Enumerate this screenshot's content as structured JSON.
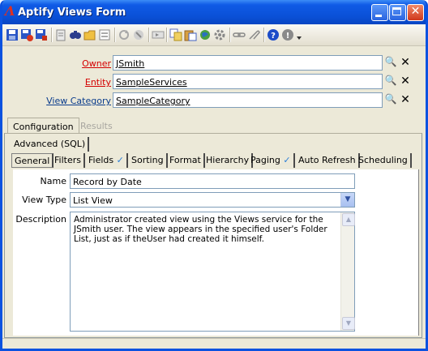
{
  "window": {
    "title": "Aptify Views Form",
    "app_logo": "Λ"
  },
  "colors": {
    "title_bar": "#0a50d6",
    "required_label": "#d40000",
    "link_label": "#0a3c8c",
    "frame": "#ece9d8"
  },
  "toolbar_icons": [
    "save-icon",
    "save-and-new-icon",
    "save-and-close-icon",
    "delete-icon",
    "find-icon",
    "open-icon",
    "form-icon",
    "refresh-icon",
    "clear-icon",
    "navigate-icon",
    "copy-icon",
    "paste-icon",
    "web-icon",
    "settings-icon",
    "link-icon",
    "attach-icon",
    "help-icon",
    "info-icon",
    "more-icon"
  ],
  "fields": [
    {
      "label": "Owner",
      "value": "JSmith",
      "label_color": "red"
    },
    {
      "label": "Entity",
      "value": "SampleServices",
      "label_color": "red"
    },
    {
      "label": "View Category",
      "value": "SampleCategory",
      "label_color": "blue"
    }
  ],
  "main_tabs": [
    {
      "label": "Configuration",
      "active": true
    },
    {
      "label": "Results",
      "active": false
    }
  ],
  "sub_tabs_row1": [
    {
      "label": "Advanced (SQL)"
    }
  ],
  "sub_tabs_row2": [
    {
      "label": "General",
      "active": true,
      "check": ""
    },
    {
      "label": "Filters",
      "check": ""
    },
    {
      "label": "Fields",
      "check": "✓"
    },
    {
      "label": "Sorting",
      "check": ""
    },
    {
      "label": "Format",
      "check": ""
    },
    {
      "label": "Hierarchy",
      "check": ""
    },
    {
      "label": "Paging",
      "check": "✓"
    },
    {
      "label": "Auto Refresh",
      "check": ""
    },
    {
      "label": "Scheduling",
      "check": ""
    }
  ],
  "general": {
    "name_label": "Name",
    "name_value": "Record by Date",
    "view_type_label": "View Type",
    "view_type_value": "List View",
    "description_label": "Description",
    "description_value": "Administrator created view using the Views service for the JSmith user. The view appears in the specified user's Folder List, just as if theUser had created it himself."
  }
}
